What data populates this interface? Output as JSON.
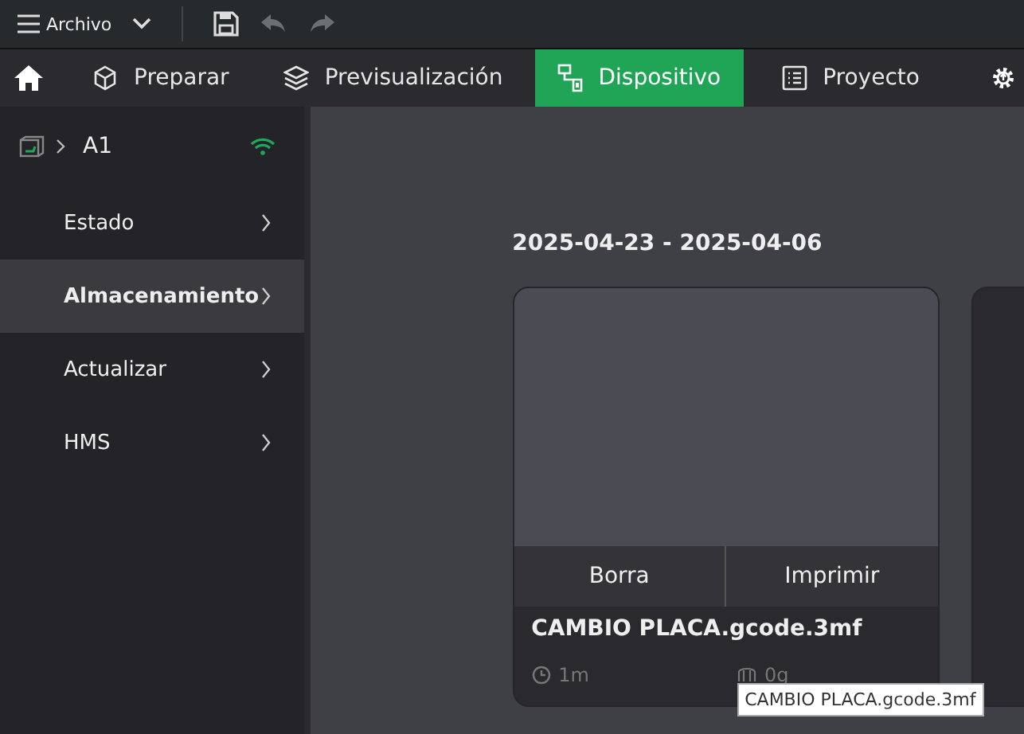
{
  "menu_bar": {
    "menu_label": "Archivo"
  },
  "tabs": [
    {
      "label": "Preparar",
      "kind": "prepare",
      "selected": false
    },
    {
      "label": "Previsualización",
      "kind": "preview",
      "selected": false
    },
    {
      "label": "Dispositivo",
      "kind": "device",
      "selected": true
    },
    {
      "label": "Proyecto",
      "kind": "project",
      "selected": false
    }
  ],
  "sidebar": {
    "printer_name": "A1",
    "items": [
      {
        "label": "Estado",
        "selected": false
      },
      {
        "label": "Almacenamiento",
        "selected": true
      },
      {
        "label": "Actualizar",
        "selected": false
      },
      {
        "label": "HMS",
        "selected": false
      }
    ]
  },
  "storage": {
    "date_range": "2025-04-23 - 2025-04-06",
    "files": [
      {
        "delete_label": "Borra",
        "print_label": "Imprimir",
        "name": "CAMBIO PLACA.gcode.3mf",
        "time": "1m",
        "weight": "0g"
      }
    ]
  },
  "tooltip": "CAMBIO PLACA.gcode.3mf"
}
